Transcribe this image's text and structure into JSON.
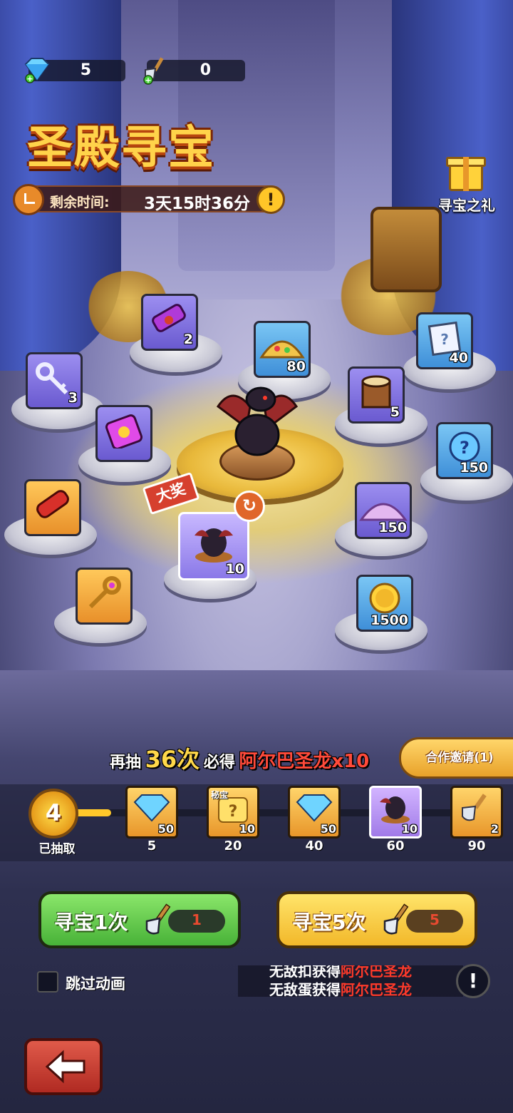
{
  "resources": {
    "gems": {
      "icon": "diamond-icon",
      "value": "5"
    },
    "shovels": {
      "icon": "shovel-icon",
      "value": "0"
    }
  },
  "event": {
    "title": "圣殿寻宝",
    "timer_label": "剩余时间:",
    "timer_value": "3天15时36分",
    "gift_label": "寻宝之礼"
  },
  "rewards": [
    {
      "id": "scroll",
      "icon": "scroll-icon",
      "qty": "2"
    },
    {
      "id": "gold-pile",
      "icon": "gold-pile-icon",
      "qty": "80"
    },
    {
      "id": "letter",
      "icon": "letter-icon",
      "qty": "40"
    },
    {
      "id": "key-silver",
      "icon": "silver-key-icon",
      "qty": "3"
    },
    {
      "id": "log",
      "icon": "log-icon",
      "qty": "5"
    },
    {
      "id": "potion",
      "icon": "potion-icon",
      "qty": ""
    },
    {
      "id": "mystery-orb",
      "icon": "mystery-orb-icon",
      "qty": "150"
    },
    {
      "id": "red-scroll",
      "icon": "red-scroll-icon",
      "qty": ""
    },
    {
      "id": "dust",
      "icon": "purple-dust-icon",
      "qty": "150"
    },
    {
      "id": "dragon-shard",
      "icon": "dragon-shard-icon",
      "qty": "10"
    },
    {
      "id": "key-gold",
      "icon": "gold-key-icon",
      "qty": ""
    },
    {
      "id": "gold-coin",
      "icon": "gold-coin-icon",
      "qty": "1500"
    }
  ],
  "grand_prize_tag": "大奖",
  "promo": {
    "pre": "再抽",
    "count": "36次",
    "mid": "必得",
    "prize": "阿尔巴圣龙x10"
  },
  "coop_button": "合作邀请(1)",
  "progress": {
    "count": "4",
    "label": "已抽取",
    "filled_fraction": 0.1,
    "milestones": [
      {
        "icon": "diamond-icon",
        "qty": "50",
        "label": "5"
      },
      {
        "icon": "secret-puzzle-icon",
        "qty": "10",
        "tag": "秘宝",
        "label": "20"
      },
      {
        "icon": "diamond-icon",
        "qty": "50",
        "label": "40"
      },
      {
        "icon": "dragon-shard-icon",
        "qty": "10",
        "label": "60"
      },
      {
        "icon": "shovel-icon",
        "qty": "2",
        "label": "90"
      }
    ]
  },
  "buttons": {
    "once": {
      "label": "寻宝1次",
      "cost": "1"
    },
    "five": {
      "label": "寻宝5次",
      "cost": "5"
    }
  },
  "skip_animation": {
    "label": "跳过动画",
    "checked": false
  },
  "ticker": {
    "line1_name": "无敌扣获得",
    "line1_prize": "阿尔巴圣龙",
    "line2_name": "无敌蛋获得",
    "line2_prize": "阿尔巴圣龙"
  },
  "colors": {
    "accent": "#ffd34a",
    "danger": "#ff3a2a",
    "green_button": "#48b238",
    "yellow_button": "#f2b82a"
  }
}
